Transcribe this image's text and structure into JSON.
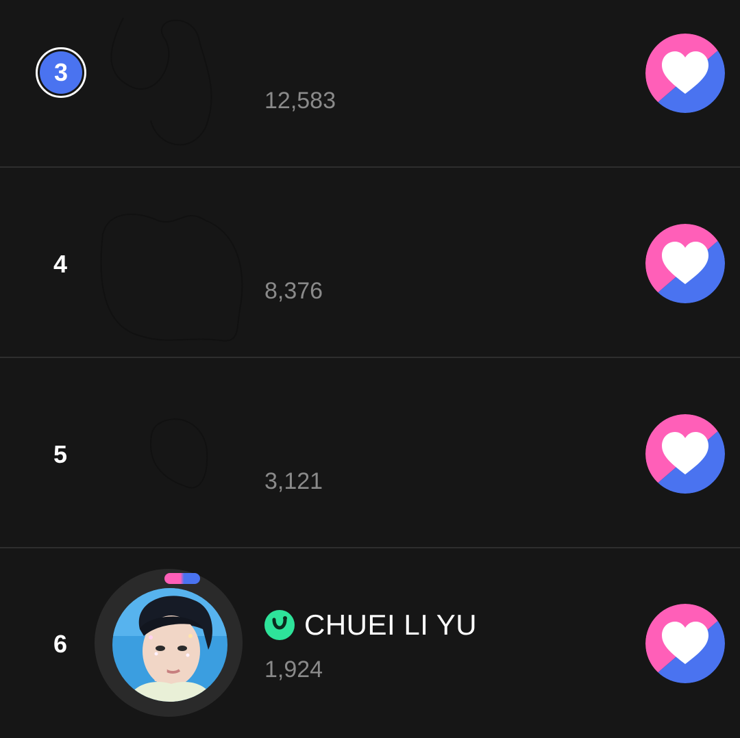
{
  "ranking": [
    {
      "rank": "3",
      "count": "12,583",
      "name": "",
      "highlighted": true
    },
    {
      "rank": "4",
      "count": "8,376",
      "name": "",
      "highlighted": false
    },
    {
      "rank": "5",
      "count": "3,121",
      "name": "",
      "highlighted": false
    },
    {
      "rank": "6",
      "count": "1,924",
      "name": "CHUEI LI YU",
      "highlighted": false,
      "verified_icon": "verified-badge-icon"
    }
  ],
  "colors": {
    "background": "#161616",
    "divider": "#2e2e2e",
    "rank_badge": "#4a73f0",
    "heart_pink": "#ff5fb8",
    "heart_blue": "#4a73f0",
    "count_text": "#8a8a8a",
    "verified": "#2ee39a"
  },
  "icons": {
    "vote_button": "heart-icon",
    "verified": "verified-badge-icon"
  }
}
